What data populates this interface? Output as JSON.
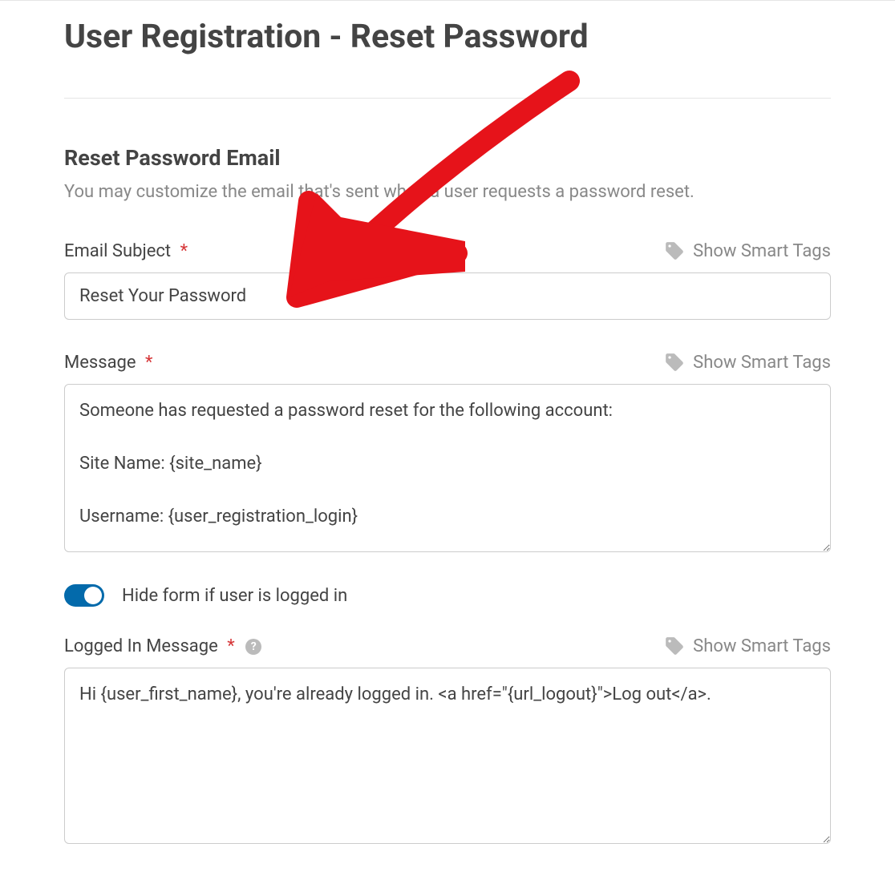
{
  "page_title": "User Registration - Reset Password",
  "section": {
    "heading": "Reset Password Email",
    "description": "You may customize the email that's sent when a user requests a password reset."
  },
  "fields": {
    "email_subject": {
      "label": "Email Subject",
      "required_marker": "*",
      "value": "Reset Your Password",
      "smart_tags_label": "Show Smart Tags"
    },
    "message": {
      "label": "Message",
      "required_marker": "*",
      "value": "Someone has requested a password reset for the following account:\n\nSite Name: {site_name}\n\nUsername: {user_registration_login}",
      "smart_tags_label": "Show Smart Tags"
    },
    "hide_toggle": {
      "label": "Hide form if user is logged in",
      "enabled": true
    },
    "logged_in_message": {
      "label": "Logged In Message",
      "required_marker": "*",
      "help_tooltip": "?",
      "value": "Hi {user_first_name}, you're already logged in. <a href=\"{url_logout}\">Log out</a>.",
      "smart_tags_label": "Show Smart Tags"
    }
  }
}
